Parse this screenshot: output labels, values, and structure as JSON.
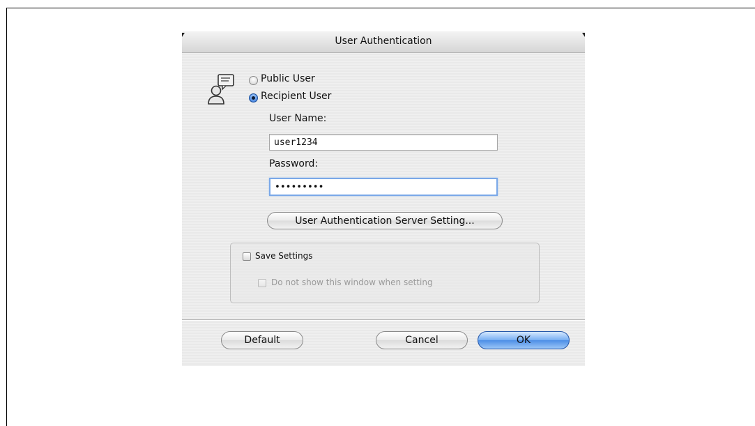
{
  "dialog": {
    "title": "User Authentication",
    "user_type": {
      "options": [
        {
          "label": "Public User",
          "selected": false
        },
        {
          "label": "Recipient User",
          "selected": true
        }
      ]
    },
    "user_name": {
      "label": "User Name:",
      "value": "user1234"
    },
    "password": {
      "label": "Password:",
      "value": "•••••••••"
    },
    "server_setting_button": "User Authentication Server Setting...",
    "save_settings": {
      "label": "Save Settings",
      "checked": false,
      "sub_option": {
        "label": "Do not show this window when setting",
        "checked": false,
        "enabled": false
      }
    },
    "buttons": {
      "default": "Default",
      "cancel": "Cancel",
      "ok": "OK"
    }
  },
  "icons": {
    "user": "user-authentication-icon"
  },
  "colors": {
    "accent": "#4d8ee6",
    "dialog_bg": "#ececec"
  }
}
